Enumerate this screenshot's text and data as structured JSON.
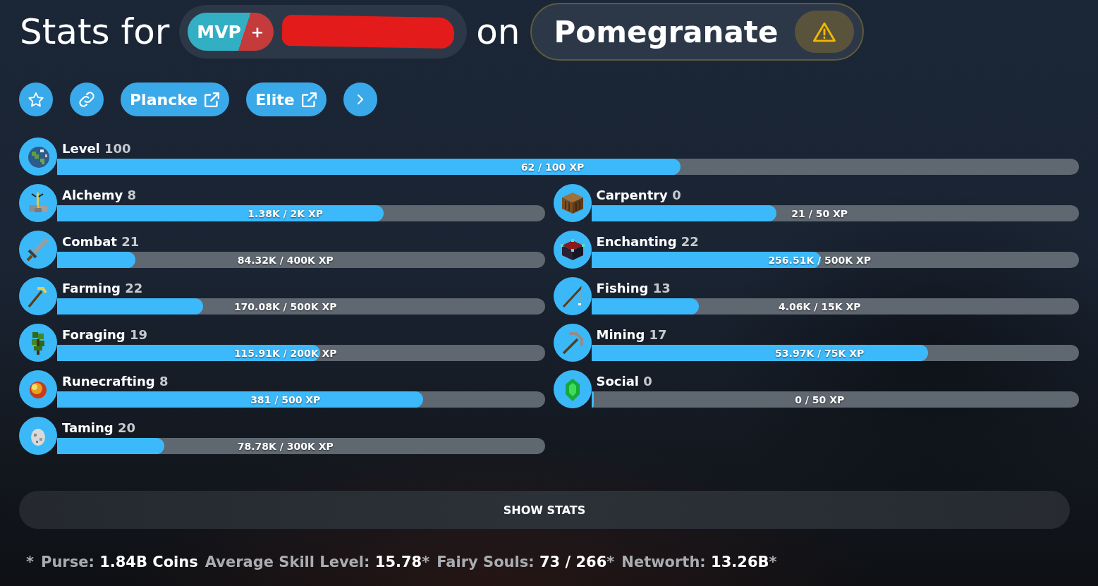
{
  "header": {
    "title": "Stats for",
    "player": {
      "rank": "MVP",
      "rank_plus": "+",
      "name_redacted": true
    },
    "connector": "on",
    "profile": {
      "name": "Pomegranate",
      "warning": true
    }
  },
  "links": [
    {
      "label": "Plancke"
    },
    {
      "label": "Elite"
    }
  ],
  "level": {
    "name": "Level",
    "value": "100",
    "progress": "62 / 100 XP",
    "level": 0.61
  },
  "skills": [
    {
      "name": "Alchemy",
      "value": "8",
      "progress": "1.38K / 2K XP",
      "level": 0.67
    },
    {
      "name": "Carpentry",
      "value": "0",
      "progress": "21 / 50 XP",
      "level": 0.38
    },
    {
      "name": "Combat",
      "value": "21",
      "progress": "84.32K / 400K XP",
      "level": 0.16
    },
    {
      "name": "Enchanting",
      "value": "22",
      "progress": "256.51K / 500K XP",
      "level": 0.47
    },
    {
      "name": "Farming",
      "value": "22",
      "progress": "170.08K / 500K XP",
      "level": 0.3
    },
    {
      "name": "Fishing",
      "value": "13",
      "progress": "4.06K / 15K XP",
      "level": 0.22
    },
    {
      "name": "Foraging",
      "value": "19",
      "progress": "115.91K / 200K XP",
      "level": 0.54
    },
    {
      "name": "Mining",
      "value": "17",
      "progress": "53.97K / 75K XP",
      "level": 0.69
    },
    {
      "name": "Runecrafting",
      "value": "8",
      "progress": "381 / 500 XP",
      "level": 0.75
    },
    {
      "name": "Social",
      "value": "0",
      "progress": "0 / 50 XP",
      "level": 0
    },
    {
      "name": "Taming",
      "value": "20",
      "progress": "78.78K / 300K XP",
      "level": 0.22
    }
  ],
  "show_stats_button": "SHOW STATS",
  "summary": {
    "lead_mark": "*",
    "stats": [
      {
        "label": "Purse:",
        "value": "1.84B Coins"
      },
      {
        "label": "Average Skill Level:",
        "value": "15.78",
        "mark": "*"
      },
      {
        "label": "Fairy Souls:",
        "value": "73 / 266",
        "mark": "*"
      },
      {
        "label": "Networth:",
        "value": "13.26B",
        "mark": "*"
      }
    ]
  }
}
